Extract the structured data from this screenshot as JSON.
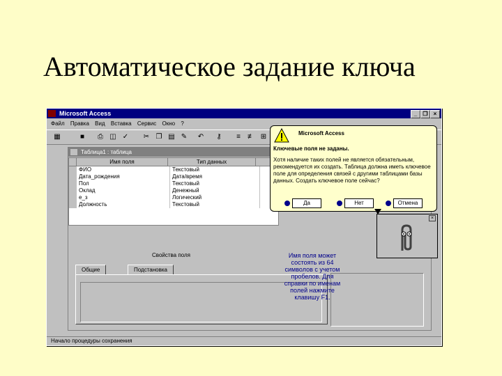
{
  "slide": {
    "title": "Автоматическое задание ключа"
  },
  "window": {
    "title": "Microsoft Access",
    "controls": {
      "minimize": "_",
      "restore": "❐",
      "close": "×"
    },
    "menu": [
      "Файл",
      "Правка",
      "Вид",
      "Вставка",
      "Сервис",
      "Окно",
      "?"
    ],
    "statusbar": "Начало процедуры сохранения"
  },
  "table_window": {
    "title": "Таблица1 : таблица",
    "columns": [
      "Имя поля",
      "Тип данных"
    ],
    "rows": [
      [
        "ФИО",
        "Текстовый"
      ],
      [
        "Дата_рождения",
        "Дата/время"
      ],
      [
        "Пол",
        "Текстовый"
      ],
      [
        "Оклад",
        "Денежный"
      ],
      [
        "е_з",
        "Логический"
      ],
      [
        "Должность",
        "Текстовый"
      ]
    ],
    "properties_header": "Свойства поля",
    "tabs": [
      "Общие",
      "Подстановка"
    ],
    "help_text": "Имя поля может состоять из 64 символов с учетом пробелов. Для справки по именам полей нажмите клавишу F1."
  },
  "dialog": {
    "title": "Microsoft Access",
    "heading": "Ключевые поля не заданы.",
    "body": "Хотя наличие таких полей не является обязательным, рекомендуется их создать. Таблица должна иметь ключевое поле для определения связей с другими таблицами базы данных. Создать ключевое поле сейчас?",
    "buttons": {
      "yes": "Да",
      "no": "Нет",
      "cancel": "Отмена"
    }
  }
}
